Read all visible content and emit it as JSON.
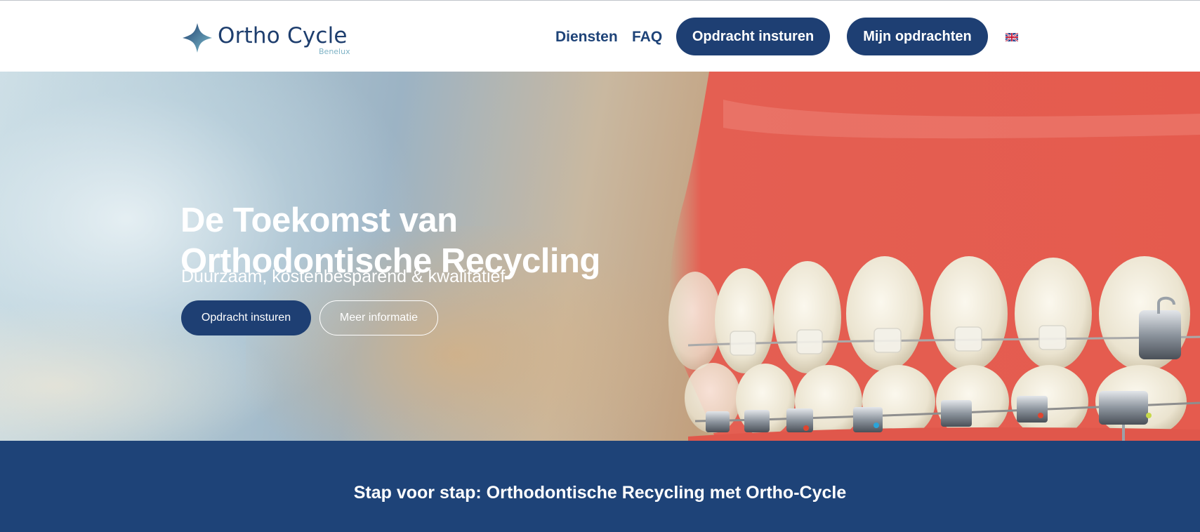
{
  "header": {
    "logo": {
      "name": "Ortho Cycle",
      "sub": "Benelux"
    },
    "nav": [
      {
        "label": "Diensten"
      },
      {
        "label": "FAQ"
      }
    ],
    "buttons": {
      "submit": "Opdracht insturen",
      "my_orders": "Mijn opdrachten"
    },
    "language_icon": "uk-flag-icon"
  },
  "hero": {
    "title_line1": "De Toekomst van",
    "title_line2": "Orthodontische Recycling",
    "subtitle": "Duurzaam, kostenbesparend & kwalitatief",
    "primary_button": "Opdracht insturen",
    "secondary_button": "Meer informatie",
    "image": "teeth-model-with-braces"
  },
  "band": {
    "title": "Stap voor stap: Orthodontische Recycling met Ortho-Cycle"
  },
  "colors": {
    "brand_navy": "#1e3f73",
    "band_navy": "#1e4378",
    "logo_accent": "#7fb3c6",
    "white": "#ffffff"
  }
}
